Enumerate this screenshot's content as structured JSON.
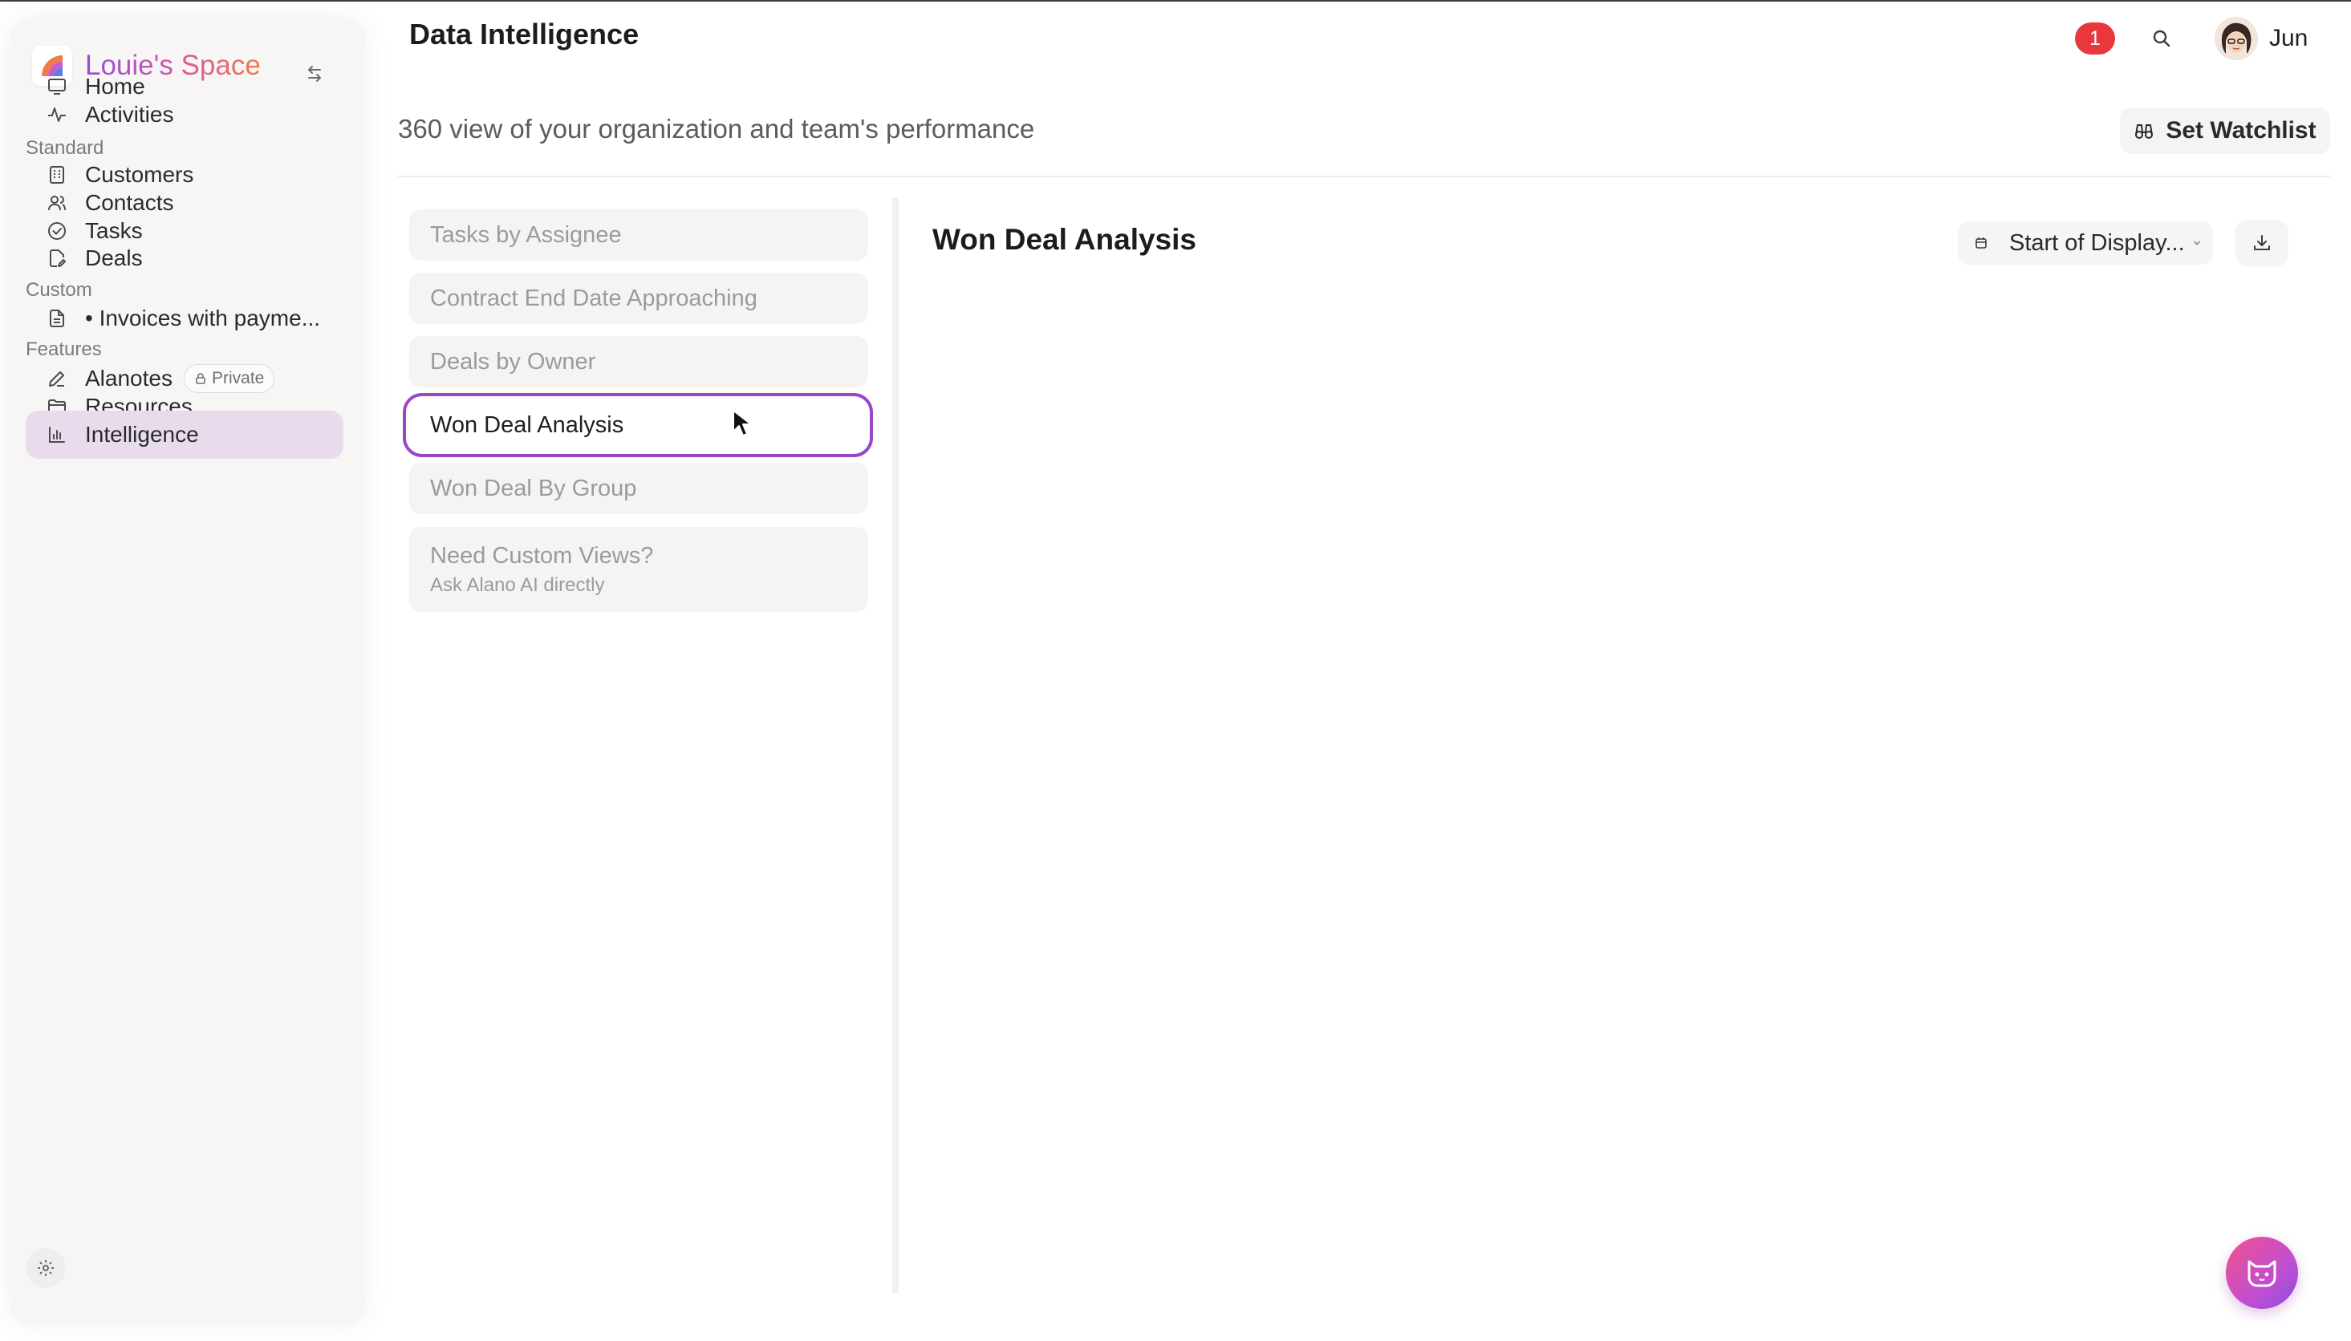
{
  "workspace": {
    "name": "Louie's Space"
  },
  "sidebar": {
    "primary": [
      {
        "label": "Home",
        "icon": "monitor-icon"
      },
      {
        "label": "Activities",
        "icon": "activity-icon"
      }
    ],
    "standard_title": "Standard",
    "standard": [
      {
        "label": "Customers",
        "icon": "building-icon"
      },
      {
        "label": "Contacts",
        "icon": "users-icon"
      },
      {
        "label": "Tasks",
        "icon": "check-circle-icon"
      },
      {
        "label": "Deals",
        "icon": "file-edit-icon"
      }
    ],
    "custom_title": "Custom",
    "custom": [
      {
        "label": "• Invoices with payme...",
        "icon": "document-icon"
      }
    ],
    "features_title": "Features",
    "features": [
      {
        "label": "Alanotes",
        "icon": "pen-icon",
        "badge": "Private"
      },
      {
        "label": "Resources",
        "icon": "folder-icon"
      },
      {
        "label": "Intelligence",
        "icon": "bar-chart-icon",
        "active": true
      }
    ]
  },
  "header": {
    "title": "Data Intelligence",
    "notifications": "1",
    "user_name": "Jun"
  },
  "page": {
    "subtitle": "360 view of your organization and team's performance",
    "watchlist_label": "Set Watchlist"
  },
  "reports": [
    {
      "label": "Tasks by Assignee"
    },
    {
      "label": "Contract End Date Approaching"
    },
    {
      "label": "Deals by Owner"
    },
    {
      "label": "Won Deal Analysis",
      "selected": true
    },
    {
      "label": "Won Deal By Group"
    }
  ],
  "custom_views": {
    "title": "Need Custom Views?",
    "subtitle": "Ask Alano AI directly"
  },
  "panel": {
    "title": "Won Deal Analysis",
    "date_filter": "Start of Display..."
  },
  "colors": {
    "accent": "#9b46c8",
    "active_nav_bg": "#e8dcec",
    "notification": "#e8383d"
  }
}
